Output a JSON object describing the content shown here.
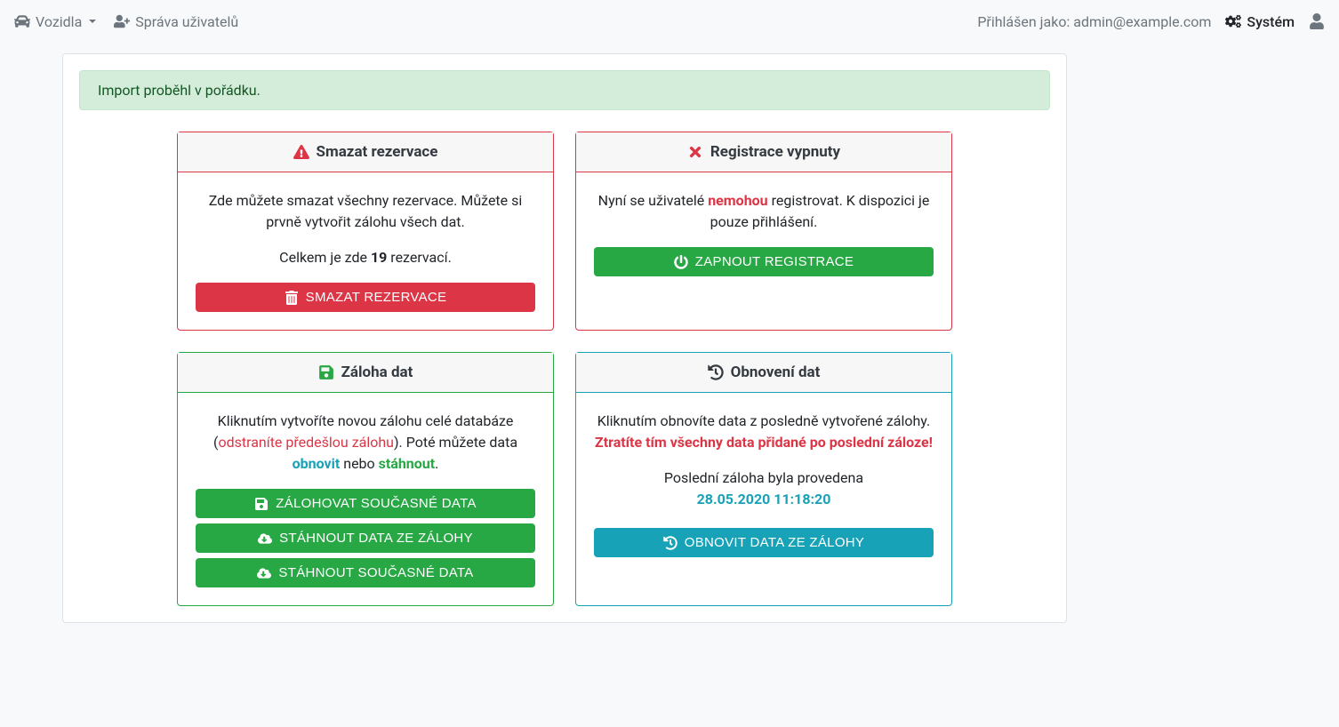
{
  "navbar": {
    "vehicles": "Vozidla",
    "user_management": "Správa uživatelů",
    "logged_in_as_prefix": "Přihlášen jako: ",
    "user_email": "admin@example.com",
    "system": "Systém"
  },
  "alert": {
    "import_success": "Import proběhl v pořádku."
  },
  "cards": {
    "delete_reservations": {
      "title": "Smazat rezervace",
      "desc": "Zde můžete smazat všechny rezervace. Můžete si prvně vytvořit zálohu všech dat.",
      "count_prefix": "Celkem je zde ",
      "count": "19",
      "count_suffix": " rezervací.",
      "button": "Smazat rezervace"
    },
    "registration": {
      "title": "Registrace vypnuty",
      "desc_prefix": "Nyní se uživatelé ",
      "desc_bold": "nemohou",
      "desc_suffix": " registrovat. K dispozici je pouze přihlášení.",
      "button": "Zapnout registrace"
    },
    "backup": {
      "title": "Záloha dat",
      "desc_part1": "Kliknutím vytvoříte novou zálohu celé databáze (",
      "desc_danger": "odstraníte předešlou zálohu",
      "desc_part2": "). Poté můžete data ",
      "desc_obnovit": "obnovit",
      "desc_nebo": " nebo ",
      "desc_stahnout": "stáhnout",
      "desc_end": ".",
      "button_backup": "Zálohovat současné data",
      "button_download_backup": "Stáhnout data ze zálohy",
      "button_download_current": "Stáhnout současné data"
    },
    "restore": {
      "title": "Obnovení dat",
      "desc_part1": "Kliknutím obnovíte data z posledně vytvořené zálohy. ",
      "desc_danger": "Ztratíte tím všechny data přidané po poslední záloze!",
      "last_backup_label": "Poslední záloha byla provedena",
      "last_backup_time": "28.05.2020 11:18:20",
      "button": "Obnovit data ze zálohy"
    }
  }
}
